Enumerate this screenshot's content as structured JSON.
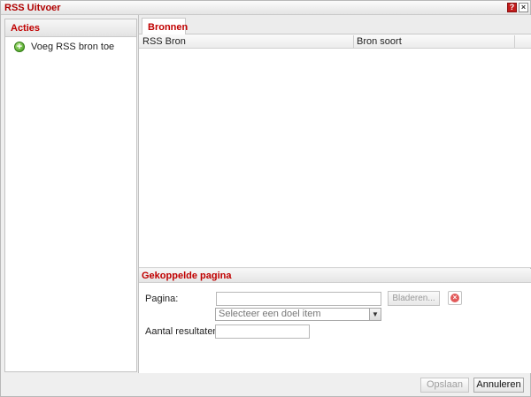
{
  "window": {
    "title": "RSS Uitvoer",
    "help_icon": "?",
    "close_icon": "×"
  },
  "sidebar": {
    "header": "Acties",
    "actions": [
      {
        "label": "Voeg RSS bron toe",
        "icon": "plus-circle-icon"
      }
    ]
  },
  "tabs": [
    {
      "label": "Bronnen",
      "active": true
    }
  ],
  "grid": {
    "columns": [
      "RSS Bron",
      "Bron soort"
    ],
    "rows": []
  },
  "linked_page": {
    "header": "Gekoppelde pagina",
    "page_label": "Pagina:",
    "page_value": "",
    "browse_label": "Bladeren...",
    "target_select": "Selecteer een doel item",
    "results_label": "Aantal resultaten:",
    "results_value": ""
  },
  "footer": {
    "save_label": "Opslaan",
    "cancel_label": "Annuleren"
  },
  "colors": {
    "accent_red": "#c00000"
  }
}
